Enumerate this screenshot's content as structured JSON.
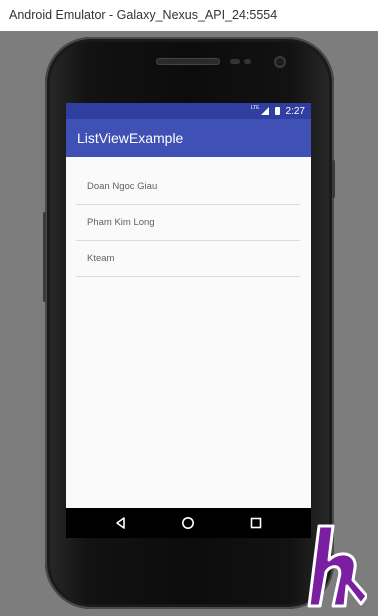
{
  "window": {
    "title": "Android Emulator - Galaxy_Nexus_API_24:5554"
  },
  "status_bar": {
    "time": "2:27",
    "network_label": "LTE"
  },
  "app_bar": {
    "title": "ListViewExample"
  },
  "list": {
    "items": [
      {
        "label": "Doan Ngoc Giau"
      },
      {
        "label": "Pham Kim Long"
      },
      {
        "label": "Kteam"
      }
    ]
  },
  "navigation": {
    "back": "back",
    "home": "home",
    "recents": "recents"
  },
  "colors": {
    "status_bar": "#303f9f",
    "app_bar": "#3f51b5",
    "screen_bg": "#fafafa",
    "logo": "#6a1b9a"
  }
}
